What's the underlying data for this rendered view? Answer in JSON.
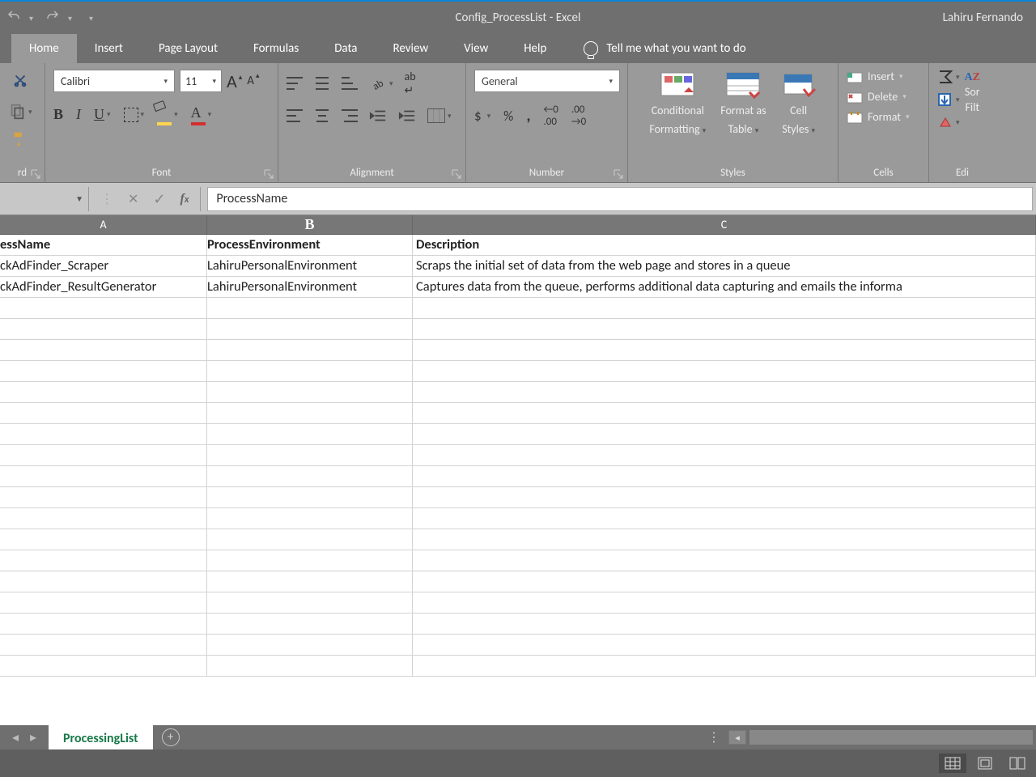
{
  "title": "Config_ProcessList  -  Excel",
  "account": "Lahiru Fernando",
  "tabs": [
    "Home",
    "Insert",
    "Page Layout",
    "Formulas",
    "Data",
    "Review",
    "View",
    "Help"
  ],
  "tellme": "Tell me what you want to do",
  "font": {
    "name": "Calibri",
    "size": "11"
  },
  "number_format": "General",
  "groups": {
    "clipboard": "rd",
    "font": "Font",
    "alignment": "Alignment",
    "number": "Number",
    "styles": "Styles",
    "cells": "Cells",
    "editing": "Edi"
  },
  "styles_btns": {
    "cond": "Conditional",
    "cond2": "Formatting",
    "fmt": "Format as",
    "fmt2": "Table",
    "cell": "Cell",
    "cell2": "Styles"
  },
  "cells_btns": {
    "insert": "Insert",
    "delete": "Delete",
    "format": "Format"
  },
  "editing_btns": {
    "sort": "Sor",
    "filter": "Filt"
  },
  "formula_bar": {
    "value": "ProcessName"
  },
  "columns": {
    "a": "A",
    "b": "B",
    "c": "C"
  },
  "sheet": {
    "header": {
      "a": "essName",
      "b": "ProcessEnvironment",
      "c": "Description"
    },
    "rows": [
      {
        "a": "ckAdFinder_Scraper",
        "b": "LahiruPersonalEnvironment",
        "c": "Scraps the initial set of data from the web page and stores in a queue"
      },
      {
        "a": "ckAdFinder_ResultGenerator",
        "b": "LahiruPersonalEnvironment",
        "c": "Captures data from the queue, performs additional data capturing and emails the informa"
      }
    ]
  },
  "sheet_tab": "ProcessingList"
}
